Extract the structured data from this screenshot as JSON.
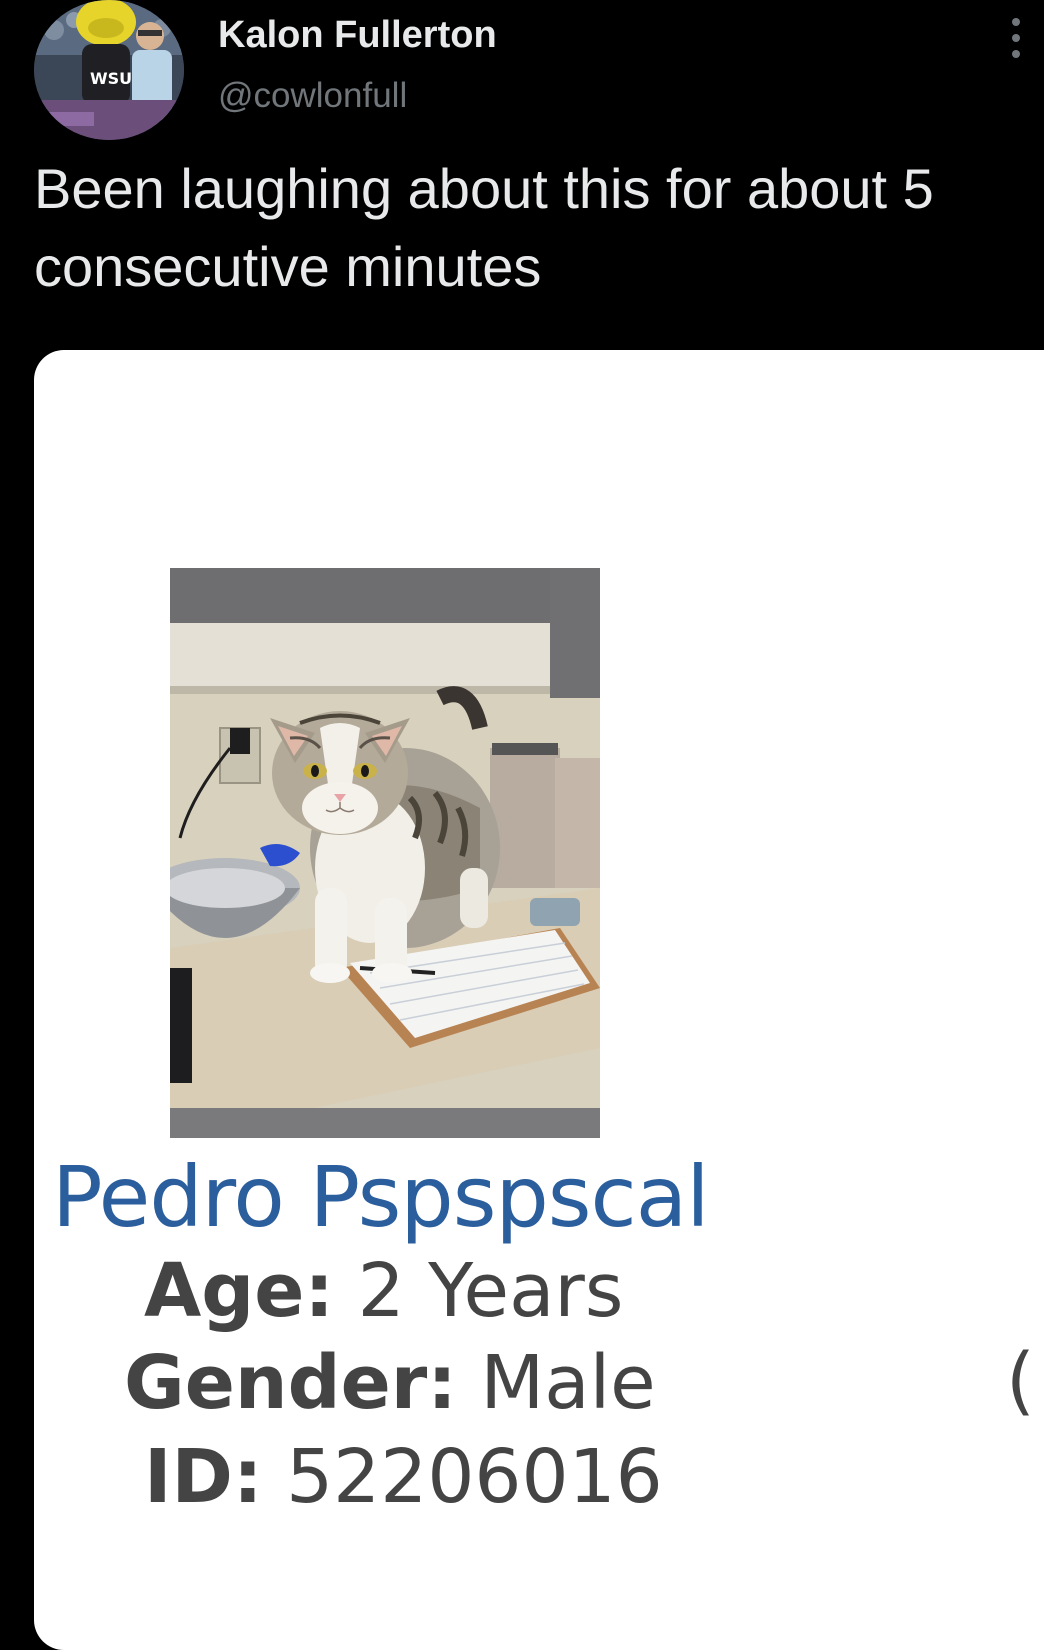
{
  "tweet": {
    "author_name": "Kalon Fullerton",
    "author_handle": "@cowlonfull",
    "text": "Been laughing about this for about 5\nconsecutive minutes",
    "more_icon": "more-vertical-icon"
  },
  "card": {
    "pet_name": "Pedro Pspspscal",
    "age_label": "Age:",
    "age_value": "2 Years",
    "gender_label": "Gender:",
    "gender_value": "Male",
    "id_label": "ID:",
    "id_value": "52206016",
    "partial_glyph": "("
  },
  "colors": {
    "background": "#000000",
    "text_primary": "#e7e9ea",
    "text_secondary": "#71767b",
    "pet_name": "#2a5e9c",
    "pet_details": "#444444"
  }
}
